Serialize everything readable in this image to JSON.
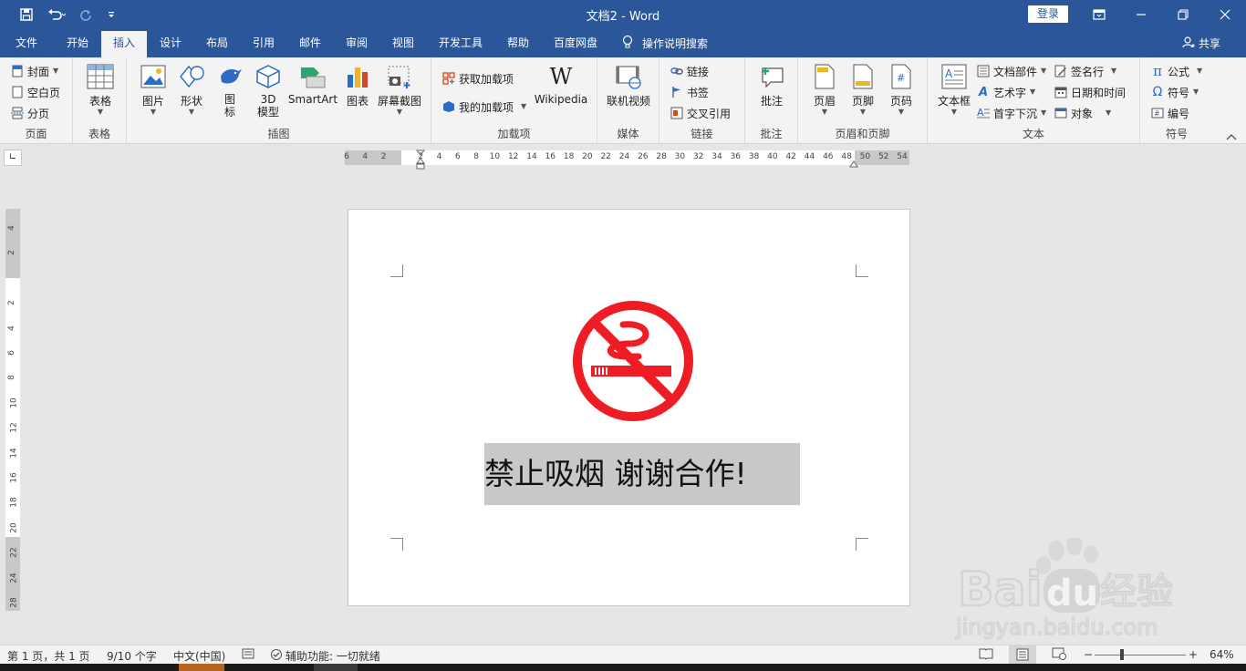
{
  "titlebar": {
    "title": "文档2  -  Word",
    "login_label": "登录",
    "bg_color": "#2b579a",
    "quick_access": [
      "save-icon",
      "undo-icon",
      "redo-icon",
      "customize-icon"
    ]
  },
  "tabs": [
    {
      "label": "文件",
      "active": false
    },
    {
      "label": "开始",
      "active": false
    },
    {
      "label": "插入",
      "active": true
    },
    {
      "label": "设计",
      "active": false
    },
    {
      "label": "布局",
      "active": false
    },
    {
      "label": "引用",
      "active": false
    },
    {
      "label": "邮件",
      "active": false
    },
    {
      "label": "审阅",
      "active": false
    },
    {
      "label": "视图",
      "active": false
    },
    {
      "label": "开发工具",
      "active": false
    },
    {
      "label": "帮助",
      "active": false
    },
    {
      "label": "百度网盘",
      "active": false
    }
  ],
  "search_tab": "操作说明搜索",
  "share_label": "共享",
  "ribbon": {
    "pages": {
      "label": "页面",
      "items": [
        "封面",
        "空白页",
        "分页"
      ]
    },
    "tables": {
      "label": "表格",
      "button": "表格"
    },
    "illustrations": {
      "label": "插图",
      "items": [
        "图片",
        "形状",
        "图标",
        "3D模型",
        "SmartArt",
        "图表",
        "屏幕截图"
      ],
      "icon_top": "图",
      "icon_bottom": "标",
      "model_top": "3D",
      "model_bottom": "模型"
    },
    "addins": {
      "label": "加载项",
      "get": "获取加载项",
      "mine": "我的加载项",
      "wiki": "Wikipedia"
    },
    "media": {
      "label": "媒体",
      "button": "联机视频"
    },
    "links": {
      "label": "链接",
      "items": [
        "链接",
        "书签",
        "交叉引用"
      ]
    },
    "comments": {
      "label": "批注",
      "button": "批注"
    },
    "header_footer": {
      "label": "页眉和页脚",
      "items": [
        "页眉",
        "页脚",
        "页码"
      ]
    },
    "text": {
      "label": "文本",
      "textbox": "文本框",
      "items": [
        "文档部件",
        "艺术字",
        "首字下沉",
        "签名行",
        "日期和时间",
        "对象"
      ]
    },
    "symbols": {
      "label": "符号",
      "items": [
        "公式",
        "符号",
        "编号"
      ]
    }
  },
  "ruler": {
    "h_ticks": [
      "6",
      "4",
      "2",
      "2",
      "4",
      "6",
      "8",
      "10",
      "12",
      "14",
      "16",
      "18",
      "20",
      "22",
      "24",
      "26",
      "28",
      "30",
      "32",
      "34",
      "36",
      "38",
      "40",
      "42",
      "44",
      "46",
      "48",
      "50",
      "52",
      "54"
    ],
    "v_ticks": [
      "4",
      "2",
      "2",
      "4",
      "6",
      "8",
      "10",
      "12",
      "14",
      "16",
      "18",
      "20",
      "22",
      "24",
      "28"
    ]
  },
  "document": {
    "slogan": "禁止吸烟  谢谢合作!",
    "sign_color": "#ee1c24"
  },
  "statusbar": {
    "page": "第 1 页，共 1 页",
    "words": "9/10 个字",
    "lang": "中文(中国)",
    "accessibility": "辅助功能: 一切就绪",
    "zoom": "64%"
  },
  "watermark": {
    "brand_left": "Bai",
    "brand_mid": "du",
    "brand_right": "经验",
    "url": "jingyan.baidu.com"
  }
}
